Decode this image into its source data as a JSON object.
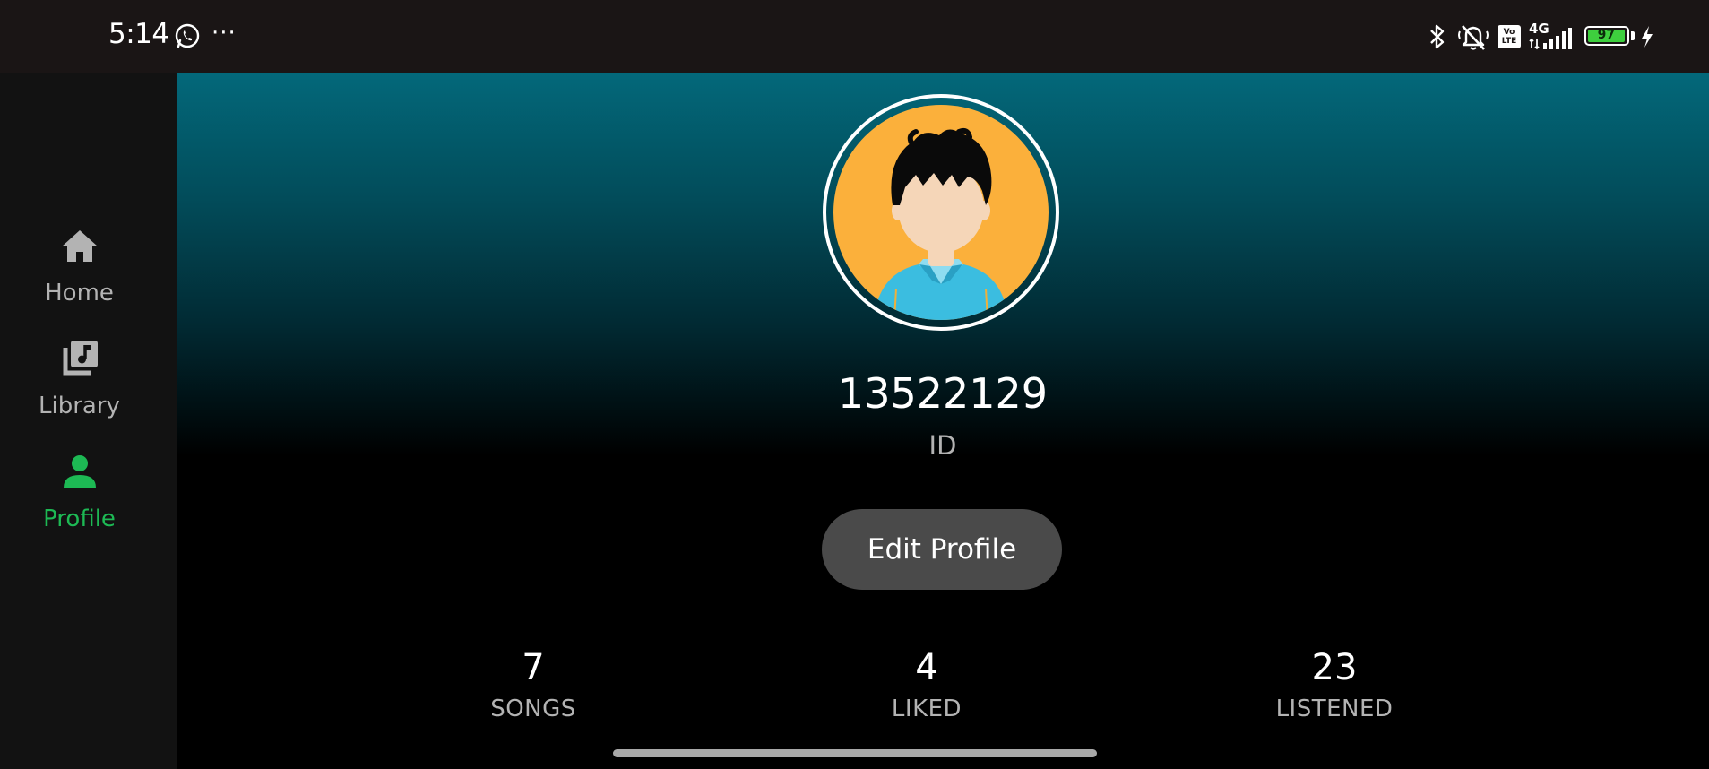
{
  "status_bar": {
    "time": "5:14",
    "more_indicator": "···",
    "battery_level": "97",
    "network_type": "4G",
    "volte_label": "Vo\nLTE",
    "icons": [
      "whatsapp-icon",
      "bluetooth-icon",
      "silent-icon",
      "volte-icon",
      "signal-icon",
      "battery-icon",
      "charging-icon"
    ]
  },
  "sidebar": {
    "items": [
      {
        "label": "Home",
        "icon": "home-icon",
        "active": false
      },
      {
        "label": "Library",
        "icon": "library-icon",
        "active": false
      },
      {
        "label": "Profile",
        "icon": "profile-icon",
        "active": true
      }
    ]
  },
  "profile": {
    "username": "13522129",
    "subtitle": "ID",
    "edit_button_label": "Edit Profile"
  },
  "stats": [
    {
      "value": "7",
      "label": "SONGS"
    },
    {
      "value": "4",
      "label": "LIKED"
    },
    {
      "value": "23",
      "label": "LISTENED"
    }
  ],
  "colors": {
    "accent": "#1db954",
    "sidebar_bg": "#121212",
    "status_bar_bg": "#1a1515",
    "gradient_top": "#03687a",
    "avatar_bg": "#fbb03b",
    "button_bg": "#4a4a4a"
  }
}
